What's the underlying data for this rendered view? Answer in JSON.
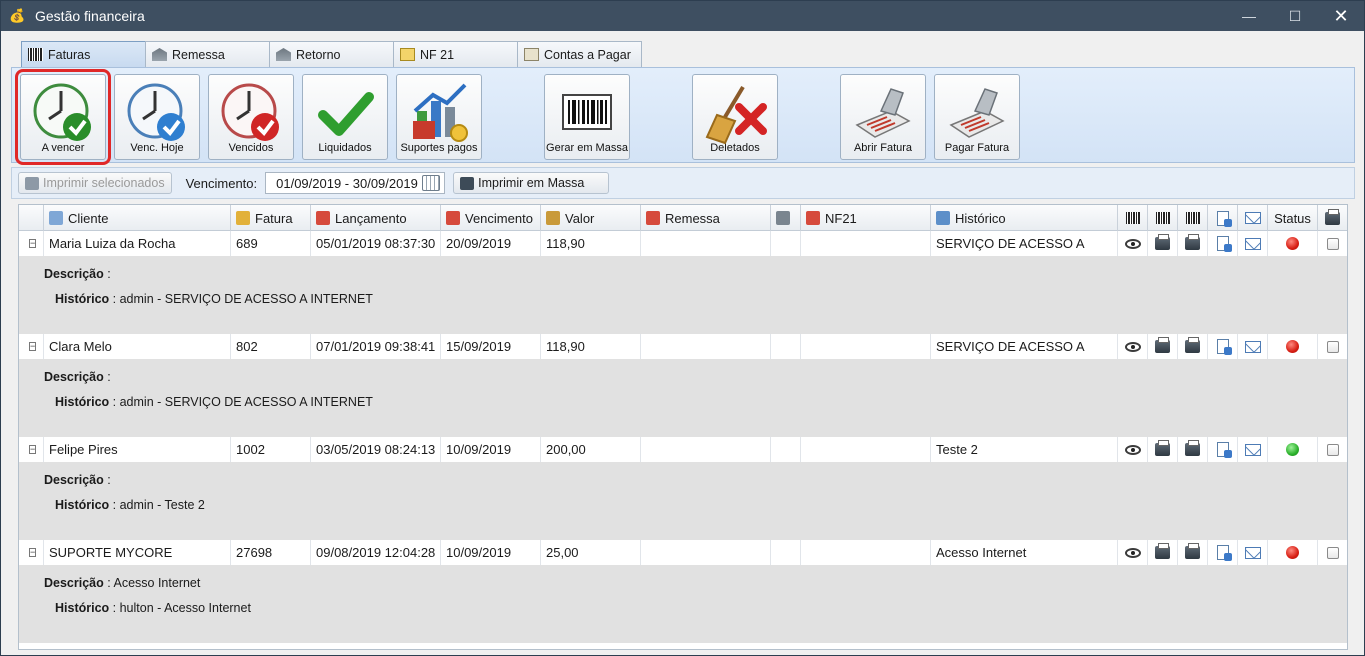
{
  "window": {
    "title": "Gestão financeira",
    "minimize": "—",
    "maximize": "☐",
    "close": "✕"
  },
  "tabs": [
    {
      "label": "Faturas",
      "icon": "barcode-icon"
    },
    {
      "label": "Remessa",
      "icon": "bank-icon"
    },
    {
      "label": "Retorno",
      "icon": "bank-return-icon"
    },
    {
      "label": "NF 21",
      "icon": "certificate-icon"
    },
    {
      "label": "Contas a Pagar",
      "icon": "bill-icon"
    }
  ],
  "toolbar": {
    "a_vencer": "A vencer",
    "venc_hoje": "Venc. Hoje",
    "vencidos": "Vencidos",
    "liquidados": "Liquidados",
    "suportes_pagos": "Suportes pagos",
    "gerar_em_massa": "Gerar em Massa",
    "deletados": "Deletados",
    "abrir_fatura": "Abrir Fatura",
    "pagar_fatura": "Pagar Fatura"
  },
  "filter": {
    "imprimir_selecionados": "Imprimir selecionados",
    "vencimento_label": "Vencimento:",
    "vencimento_range": "01/09/2019 - 30/09/2019",
    "imprimir_em_massa": "Imprimir em Massa"
  },
  "columns": {
    "cliente": "Cliente",
    "fatura": "Fatura",
    "lancamento": "Lançamento",
    "vencimento": "Vencimento",
    "valor": "Valor",
    "remessa": "Remessa",
    "nf21": "NF21",
    "historico": "Histórico",
    "status": "Status"
  },
  "labels": {
    "descricao": "Descrição",
    "historico": "Histórico",
    "sep": " : "
  },
  "rows": [
    {
      "cliente": "Maria Luiza da Rocha",
      "fatura": "689",
      "lancamento": "05/01/2019 08:37:30",
      "vencimento": "20/09/2019",
      "valor": "118,90",
      "historico": "SERVIÇO DE ACESSO A",
      "status": "red",
      "descricao": "",
      "historico_full": "admin - SERVIÇO DE ACESSO A INTERNET"
    },
    {
      "cliente": "Clara Melo",
      "fatura": "802",
      "lancamento": "07/01/2019 09:38:41",
      "vencimento": "15/09/2019",
      "valor": "118,90",
      "historico": "SERVIÇO DE ACESSO A",
      "status": "red",
      "descricao": "",
      "historico_full": "admin - SERVIÇO DE ACESSO A INTERNET"
    },
    {
      "cliente": "Felipe Pires",
      "fatura": "1002",
      "lancamento": "03/05/2019 08:24:13",
      "vencimento": "10/09/2019",
      "valor": "200,00",
      "historico": "Teste 2",
      "status": "green",
      "descricao": "",
      "historico_full": "admin - Teste 2"
    },
    {
      "cliente": "SUPORTE MYCORE",
      "fatura": "27698",
      "lancamento": "09/08/2019 12:04:28",
      "vencimento": "10/09/2019",
      "valor": "25,00",
      "historico": "Acesso Internet",
      "status": "red",
      "descricao": "Acesso Internet",
      "historico_full": "hulton - Acesso Internet"
    }
  ],
  "colors": {
    "accent": "#3e4f61",
    "selected_outline": "#e02828",
    "status_red": "#d71f14",
    "status_green": "#2bb12b"
  }
}
